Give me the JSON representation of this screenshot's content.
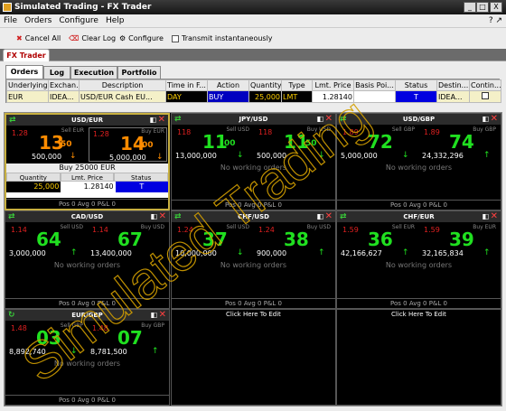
{
  "window": {
    "title": "Simulated Trading - FX Trader",
    "min": "_",
    "max": "□",
    "close": "X"
  },
  "menu": [
    "File",
    "Orders",
    "Configure",
    "Help"
  ],
  "menu_right": "? ↗",
  "toolbar": {
    "cancel_all": "Cancel All",
    "clear_log": "Clear Log",
    "configure": "Configure",
    "transmit": "Transmit instantaneously"
  },
  "fx_tab": "FX Trader",
  "subtabs": [
    "Orders",
    "Log",
    "Execution",
    "Portfolio"
  ],
  "order_grid": {
    "headers": [
      "Underlying",
      "Exchan...",
      "Description",
      "Time in F...",
      "Action",
      "Quantity",
      "Type",
      "Lmt. Price",
      "Basis Poi...",
      "Status",
      "Destin...",
      "Contin..."
    ],
    "row": [
      "EUR",
      "IDEA...",
      "USD/EUR Cash EU...",
      "DAY",
      "BUY",
      "25,000",
      "LMT",
      "1.28140",
      "",
      "T",
      "IDEA...",
      ""
    ]
  },
  "tiles": [
    {
      "pair": "USD/EUR",
      "sell": {
        "label": "Sell EUR",
        "pre": "1.28",
        "big": "13",
        "sup": "50",
        "size": "500,000",
        "dir": "↓",
        "big_color": "#ff8c00"
      },
      "buy": {
        "label": "Buy EUR",
        "pre": "1.28",
        "big": "14",
        "sup": "00",
        "size": "5,000,000",
        "dir": "↓",
        "big_color": "#ff8c00"
      },
      "order": {
        "title": "Buy 25000 EUR",
        "cols": [
          "Quantity",
          "Lmt. Price",
          "Status"
        ],
        "vals": [
          "25,000",
          "1.28140",
          "T"
        ]
      },
      "footer": "Pos 0    Avg 0    P&L 0"
    },
    {
      "pair": "JPY/USD",
      "sell": {
        "label": "Sell USD",
        "pre": "118",
        "big": "11",
        "sup": "00",
        "size": "13,000,000",
        "dir": "↓",
        "big_color": "#20e020"
      },
      "buy": {
        "label": "Buy USD",
        "pre": "118",
        "big": "11",
        "sup": "50",
        "size": "500,000",
        "dir": "↓",
        "big_color": "#20e020"
      },
      "no_orders": "No working orders",
      "footer": "Pos 0    Avg 0    P&L 0"
    },
    {
      "pair": "USD/GBP",
      "sell": {
        "label": "Sell GBP",
        "pre": "1.89",
        "big": "72",
        "sup": "",
        "size": "5,000,000",
        "dir": "↓",
        "big_color": "#20e020"
      },
      "buy": {
        "label": "Buy GBP",
        "pre": "1.89",
        "big": "74",
        "sup": "",
        "size": "24,332,296",
        "dir": "↑",
        "big_color": "#20e020"
      },
      "no_orders": "No working orders",
      "footer": "Pos 0    Avg 0    P&L 0"
    },
    {
      "pair": "CAD/USD",
      "sell": {
        "label": "Sell USD",
        "pre": "1.14",
        "big": "64",
        "sup": "",
        "size": "3,000,000",
        "dir": "↑",
        "big_color": "#20e020"
      },
      "buy": {
        "label": "Buy USD",
        "pre": "1.14",
        "big": "67",
        "sup": "",
        "size": "13,400,000",
        "dir": "",
        "big_color": "#20e020"
      },
      "no_orders": "No working orders",
      "footer": "Pos 0    Avg 0    P&L 0"
    },
    {
      "pair": "CHF/USD",
      "sell": {
        "label": "Sell USD",
        "pre": "1.24",
        "big": "37",
        "sup": "",
        "size": "10,000,000",
        "dir": "↓",
        "big_color": "#20e020"
      },
      "buy": {
        "label": "Buy USD",
        "pre": "1.24",
        "big": "38",
        "sup": "",
        "size": "900,000",
        "dir": "↑",
        "big_color": "#20e020"
      },
      "no_orders": "No working orders",
      "footer": "Pos 0    Avg 0    P&L 0"
    },
    {
      "pair": "CHF/EUR",
      "sell": {
        "label": "Sell EUR",
        "pre": "1.59",
        "big": "36",
        "sup": "",
        "size": "42,166,627",
        "dir": "↑",
        "big_color": "#20e020"
      },
      "buy": {
        "label": "Buy EUR",
        "pre": "1.59",
        "big": "39",
        "sup": "",
        "size": "32,165,834",
        "dir": "↑",
        "big_color": "#20e020"
      },
      "no_orders": "No working orders",
      "footer": "Pos 0    Avg 0    P&L 0"
    },
    {
      "pair": "EUR/GBP",
      "sell": {
        "label": "Sell GBP",
        "pre": "1.48",
        "big": "03",
        "sup": "",
        "size": "8,892,740",
        "dir": "↓",
        "big_color": "#20e020"
      },
      "buy": {
        "label": "Buy GBP",
        "pre": "1.48",
        "big": "07",
        "sup": "",
        "size": "8,781,500",
        "dir": "↑",
        "big_color": "#20e020"
      },
      "no_orders": "No working orders",
      "footer": "Pos 0    Avg 0    P&L 0"
    }
  ],
  "edit_caption": "Click Here To Edit",
  "watermark": "Simulated Trading"
}
